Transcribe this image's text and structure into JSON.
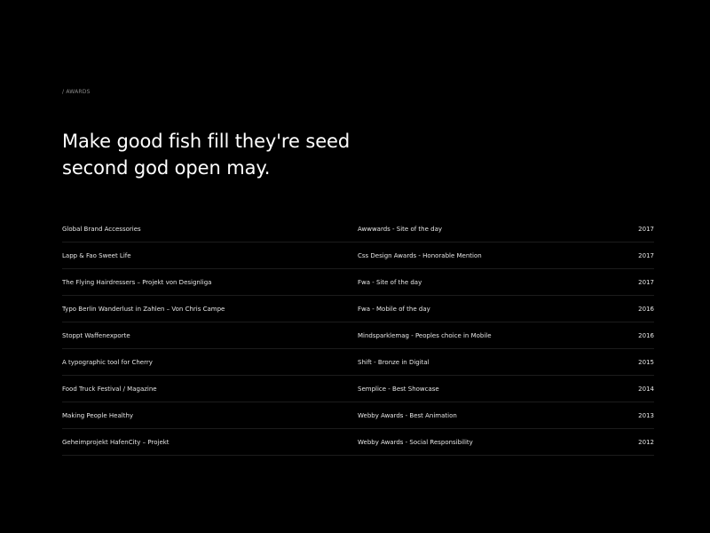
{
  "section": {
    "label": "/ AWARDS"
  },
  "headline": "Make good fish fill they're seed second god open may.",
  "awards": [
    {
      "project": "Global Brand Accessories",
      "award": "Awwwards - Site of the day",
      "year": "2017"
    },
    {
      "project": "Lapp & Fao Sweet Life",
      "award": "Css Design Awards - Honorable Mention",
      "year": "2017"
    },
    {
      "project": "The Flying Hairdressers – Projekt von Designliga",
      "award": "Fwa - Site of the day",
      "year": "2017"
    },
    {
      "project": "Typo Berlin Wanderlust in Zahlen – Von Chris Campe",
      "award": "Fwa - Mobile of the day",
      "year": "2016"
    },
    {
      "project": "Stoppt Waffenexporte",
      "award": "Mindsparklemag - Peoples choice in Mobile",
      "year": "2016"
    },
    {
      "project": "A typographic tool for Cherry",
      "award": "Shift - Bronze in Digital",
      "year": "2015"
    },
    {
      "project": "Food Truck Festival / Magazine",
      "award": "Semplice - Best Showcase",
      "year": "2014"
    },
    {
      "project": "Making People Healthy",
      "award": "Webby Awards - Best Animation",
      "year": "2013"
    },
    {
      "project": "Geheimprojekt HafenCity – Projekt",
      "award": "Webby Awards - Social Responsibility",
      "year": "2012"
    }
  ],
  "colors": {
    "background": "#000000",
    "text": "#ffffff",
    "muted": "#8a8a8a",
    "divider": "#1c1c1c"
  }
}
